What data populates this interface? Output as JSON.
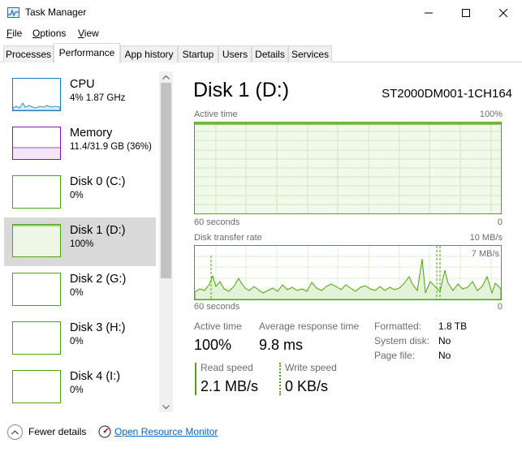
{
  "window": {
    "title": "Task Manager"
  },
  "menu": {
    "file": "File",
    "options": "Options",
    "view": "View"
  },
  "tabs": [
    "Processes",
    "Performance",
    "App history",
    "Startup",
    "Users",
    "Details",
    "Services"
  ],
  "sidebar": {
    "items": [
      {
        "name": "CPU",
        "sub": "4%  1.87 GHz"
      },
      {
        "name": "Memory",
        "sub": "11.4/31.9 GB (36%)"
      },
      {
        "name": "Disk 0 (C:)",
        "sub": "0%"
      },
      {
        "name": "Disk 1 (D:)",
        "sub": "100%"
      },
      {
        "name": "Disk 2 (G:)",
        "sub": "0%"
      },
      {
        "name": "Disk 3 (H:)",
        "sub": "0%"
      },
      {
        "name": "Disk 4 (I:)",
        "sub": "0%"
      }
    ]
  },
  "main": {
    "title": "Disk 1 (D:)",
    "model": "ST2000DM001-1CH164",
    "active_graph": {
      "label": "Active time",
      "max": "100%",
      "xlabel": "60 seconds",
      "min": "0"
    },
    "transfer_graph": {
      "label": "Disk transfer rate",
      "max": "10 MB/s",
      "mid": "7 MB/s",
      "xlabel": "60 seconds",
      "min": "0"
    },
    "stats": {
      "active_time_label": "Active time",
      "active_time_value": "100%",
      "avg_response_label": "Average response time",
      "avg_response_value": "9.8 ms",
      "read_label": "Read speed",
      "read_value": "2.1 MB/s",
      "write_label": "Write speed",
      "write_value": "0 KB/s"
    },
    "props": {
      "formatted_key": "Formatted:",
      "formatted_val": "1.8 TB",
      "system_key": "System disk:",
      "system_val": "No",
      "pagefile_key": "Page file:",
      "pagefile_val": "No"
    }
  },
  "footer": {
    "fewer": "Fewer details",
    "resmon": "Open Resource Monitor"
  },
  "colors": {
    "disk": "#4da60c",
    "cpu": "#117dbb",
    "memory": "#8b12ae"
  }
}
